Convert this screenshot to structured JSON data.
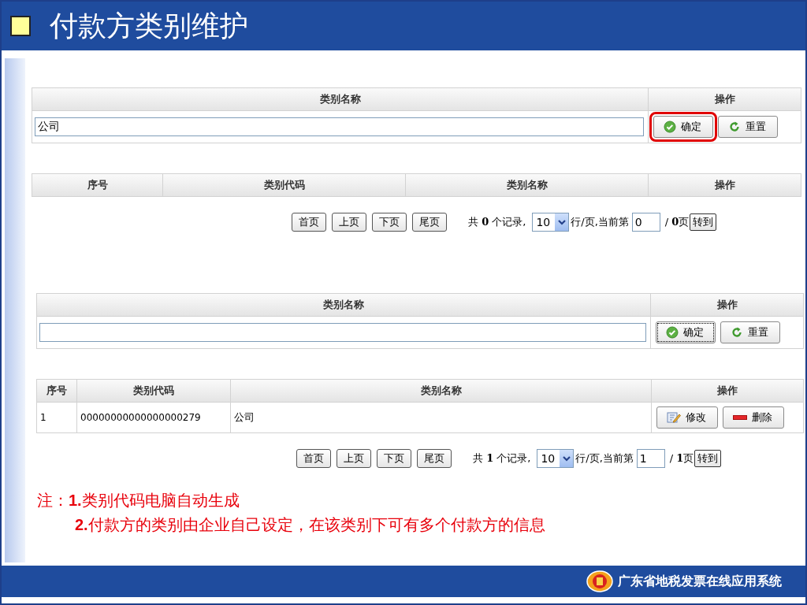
{
  "slide": {
    "title": "付款方类别维护",
    "footer": "广东省地税发票在线应用系统"
  },
  "panels": [
    {
      "form": {
        "columns": [
          "类别名称",
          "操作"
        ],
        "value": "公司",
        "buttons": [
          {
            "label": "确定",
            "kind": "confirm",
            "highlighted": true,
            "focused": false
          },
          {
            "label": "重置",
            "kind": "reset",
            "highlighted": false,
            "focused": false
          }
        ]
      },
      "list": {
        "columns": [
          "序号",
          "类别代码",
          "类别名称",
          "操作"
        ]
      },
      "pager": {
        "buttons": [
          "首页",
          "上页",
          "下页",
          "尾页"
        ],
        "total": "共 **0** 个记录,",
        "page_size": "10",
        "per_page": "行/页,当前第",
        "current_page": "0",
        "pages": "/ **0**页",
        "goto": "转到"
      }
    },
    {
      "form": {
        "columns": [
          "类别名称",
          "操作"
        ],
        "buttons": [
          {
            "label": "确定",
            "kind": "confirm",
            "highlighted": false,
            "focused": true
          },
          {
            "label": "重置",
            "kind": "reset",
            "highlighted": false,
            "focused": false
          }
        ]
      },
      "list": {
        "columns": [
          "序号",
          "类别代码",
          "类别名称",
          "操作"
        ],
        "rows": [
          {
            "cells": [
              "1",
              "00000000000000000279",
              "公司"
            ],
            "actions": [
              {
                "label": "修改",
                "kind": "edit"
              },
              {
                "label": "删除",
                "kind": "delete"
              }
            ]
          }
        ]
      },
      "pager": {
        "buttons": [
          "首页",
          "上页",
          "下页",
          "尾页"
        ],
        "total": "共 **1** 个记录,",
        "page_size": "10",
        "per_page": "行/页,当前第",
        "current_page": "1",
        "pages": "/ **1**页",
        "goto": "转到"
      }
    }
  ],
  "note": {
    "label": "注：",
    "items": [
      "**1.**类别代码电脑自动生成",
      "**2.**付款方的类别由企业自己设定，在该类别下可有多个付款方的信息"
    ]
  }
}
